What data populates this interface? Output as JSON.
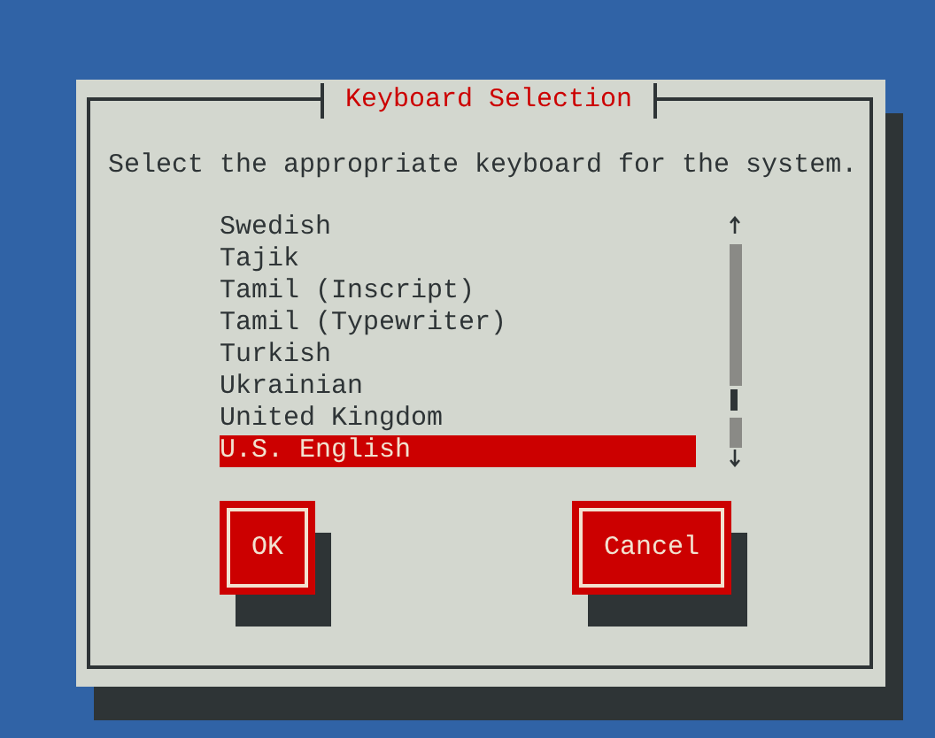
{
  "dialog": {
    "title": "Keyboard Selection",
    "prompt": "Select the appropriate keyboard for the system.",
    "items": [
      {
        "label": "Swedish",
        "selected": false
      },
      {
        "label": "Tajik",
        "selected": false
      },
      {
        "label": "Tamil (Inscript)",
        "selected": false
      },
      {
        "label": "Tamil (Typewriter)",
        "selected": false
      },
      {
        "label": "Turkish",
        "selected": false
      },
      {
        "label": "Ukrainian",
        "selected": false
      },
      {
        "label": "United Kingdom",
        "selected": false
      },
      {
        "label": "U.S. English",
        "selected": true
      }
    ],
    "buttons": [
      {
        "label": "OK"
      },
      {
        "label": "Cancel"
      }
    ]
  }
}
